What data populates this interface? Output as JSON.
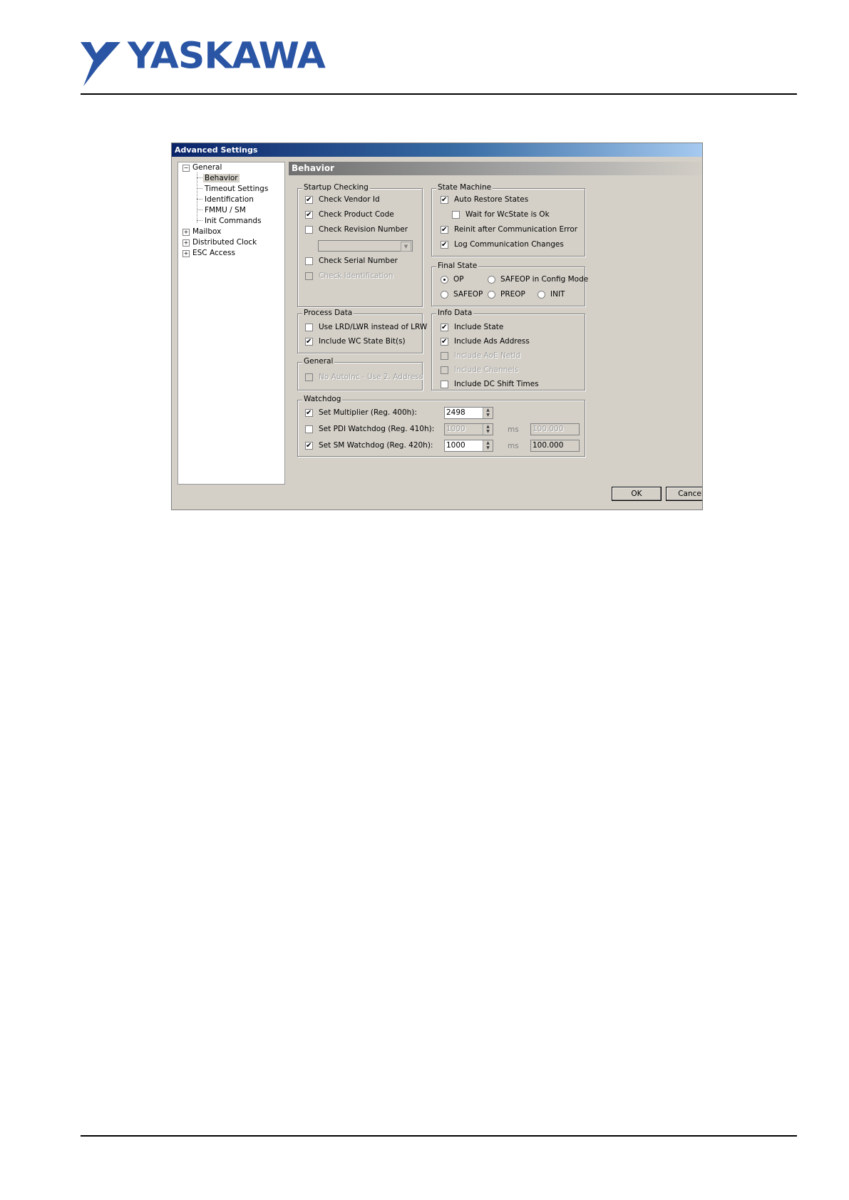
{
  "logo": {
    "text": "YASKAWA"
  },
  "dialog": {
    "title": "Advanced Settings",
    "tree": [
      {
        "label": "General"
      },
      {
        "label": "Behavior"
      },
      {
        "label": "Timeout Settings"
      },
      {
        "label": "Identification"
      },
      {
        "label": "FMMU / SM"
      },
      {
        "label": "Init Commands"
      },
      {
        "label": "Mailbox"
      },
      {
        "label": "Distributed Clock"
      },
      {
        "label": "ESC Access"
      }
    ],
    "section_title": "Behavior",
    "startup_checking": {
      "legend": "Startup Checking",
      "items": [
        {
          "label": "Check Vendor Id",
          "checked": true
        },
        {
          "label": "Check Product Code",
          "checked": true
        },
        {
          "label": "Check Revision Number",
          "checked": false
        },
        {
          "label": "Check Serial Number",
          "checked": false
        },
        {
          "label": "Check Identification",
          "checked": false,
          "disabled": true
        }
      ]
    },
    "state_machine": {
      "legend": "State Machine",
      "items": [
        {
          "label": "Auto Restore States",
          "checked": true
        },
        {
          "label": "Wait for WcState is Ok",
          "checked": false
        },
        {
          "label": "Reinit after Communication Error",
          "checked": true
        },
        {
          "label": "Log Communication Changes",
          "checked": true
        }
      ]
    },
    "final_state": {
      "legend": "Final State",
      "options": [
        {
          "label": "OP",
          "selected": true
        },
        {
          "label": "SAFEOP in Config Mode",
          "selected": false
        },
        {
          "label": "SAFEOP",
          "selected": false
        },
        {
          "label": "PREOP",
          "selected": false
        },
        {
          "label": "INIT",
          "selected": false
        }
      ]
    },
    "process_data": {
      "legend": "Process Data",
      "items": [
        {
          "label": "Use LRD/LWR instead of LRW",
          "checked": false
        },
        {
          "label": "Include WC State Bit(s)",
          "checked": true
        }
      ]
    },
    "info_data": {
      "legend": "Info Data",
      "items": [
        {
          "label": "Include State",
          "checked": true
        },
        {
          "label": "Include Ads Address",
          "checked": true
        },
        {
          "label": "Include AoE NetId",
          "checked": false,
          "disabled": true
        },
        {
          "label": "Include Channels",
          "checked": false,
          "disabled": true
        },
        {
          "label": "Include DC Shift Times",
          "checked": false
        }
      ]
    },
    "general": {
      "legend": "General",
      "items": [
        {
          "label": "No AutoInc - Use 2. Address",
          "checked": false,
          "disabled": true
        }
      ]
    },
    "watchdog": {
      "legend": "Watchdog",
      "rows": [
        {
          "label": "Set Multiplier (Reg. 400h):",
          "checked": true,
          "value": "2498",
          "unit": "",
          "readout": ""
        },
        {
          "label": "Set PDI Watchdog (Reg. 410h):",
          "checked": false,
          "value": "1000",
          "unit": "ms",
          "readout": "100.000"
        },
        {
          "label": "Set SM Watchdog (Reg. 420h):",
          "checked": true,
          "value": "1000",
          "unit": "ms",
          "readout": "100.000"
        }
      ]
    },
    "ok_label": "OK",
    "cancel_label": "Cancel"
  }
}
